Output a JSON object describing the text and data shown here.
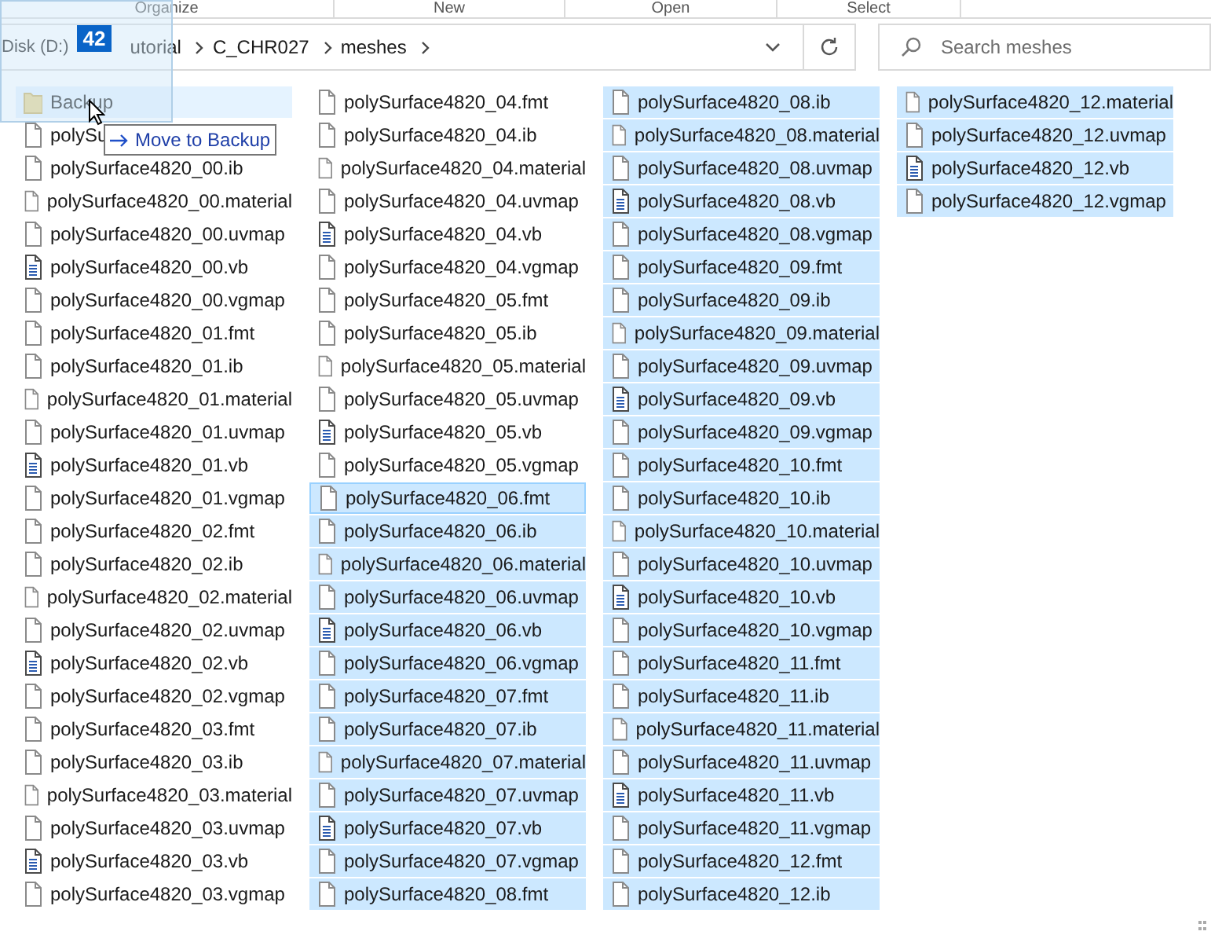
{
  "ribbon_groups": [
    "Organize",
    "New",
    "Open",
    "Select"
  ],
  "address_bar": {
    "segments": [
      "Disk (D:)",
      "utorial",
      "C_CHR027",
      "meshes"
    ]
  },
  "search": {
    "placeholder": "Search meshes"
  },
  "drag": {
    "count": "42",
    "tooltip": "Move to Backup"
  },
  "files": [
    {
      "name": "Backup",
      "kind": "folder",
      "selected": false,
      "focused": false,
      "hovered": true
    },
    {
      "name": "polySu",
      "kind": "file",
      "selected": false,
      "focused": false,
      "hovered": false
    },
    {
      "name": "polySurface4820_00.ib",
      "kind": "file",
      "selected": false,
      "focused": false,
      "hovered": false
    },
    {
      "name": "polySurface4820_00.material",
      "kind": "file",
      "selected": false,
      "focused": false,
      "hovered": false
    },
    {
      "name": "polySurface4820_00.uvmap",
      "kind": "file",
      "selected": false,
      "focused": false,
      "hovered": false
    },
    {
      "name": "polySurface4820_00.vb",
      "kind": "document",
      "selected": false,
      "focused": false,
      "hovered": false
    },
    {
      "name": "polySurface4820_00.vgmap",
      "kind": "file",
      "selected": false,
      "focused": false,
      "hovered": false
    },
    {
      "name": "polySurface4820_01.fmt",
      "kind": "file",
      "selected": false,
      "focused": false,
      "hovered": false
    },
    {
      "name": "polySurface4820_01.ib",
      "kind": "file",
      "selected": false,
      "focused": false,
      "hovered": false
    },
    {
      "name": "polySurface4820_01.material",
      "kind": "file",
      "selected": false,
      "focused": false,
      "hovered": false
    },
    {
      "name": "polySurface4820_01.uvmap",
      "kind": "file",
      "selected": false,
      "focused": false,
      "hovered": false
    },
    {
      "name": "polySurface4820_01.vb",
      "kind": "document",
      "selected": false,
      "focused": false,
      "hovered": false
    },
    {
      "name": "polySurface4820_01.vgmap",
      "kind": "file",
      "selected": false,
      "focused": false,
      "hovered": false
    },
    {
      "name": "polySurface4820_02.fmt",
      "kind": "file",
      "selected": false,
      "focused": false,
      "hovered": false
    },
    {
      "name": "polySurface4820_02.ib",
      "kind": "file",
      "selected": false,
      "focused": false,
      "hovered": false
    },
    {
      "name": "polySurface4820_02.material",
      "kind": "file",
      "selected": false,
      "focused": false,
      "hovered": false
    },
    {
      "name": "polySurface4820_02.uvmap",
      "kind": "file",
      "selected": false,
      "focused": false,
      "hovered": false
    },
    {
      "name": "polySurface4820_02.vb",
      "kind": "document",
      "selected": false,
      "focused": false,
      "hovered": false
    },
    {
      "name": "polySurface4820_02.vgmap",
      "kind": "file",
      "selected": false,
      "focused": false,
      "hovered": false
    },
    {
      "name": "polySurface4820_03.fmt",
      "kind": "file",
      "selected": false,
      "focused": false,
      "hovered": false
    },
    {
      "name": "polySurface4820_03.ib",
      "kind": "file",
      "selected": false,
      "focused": false,
      "hovered": false
    },
    {
      "name": "polySurface4820_03.material",
      "kind": "file",
      "selected": false,
      "focused": false,
      "hovered": false
    },
    {
      "name": "polySurface4820_03.uvmap",
      "kind": "file",
      "selected": false,
      "focused": false,
      "hovered": false
    },
    {
      "name": "polySurface4820_03.vb",
      "kind": "document",
      "selected": false,
      "focused": false,
      "hovered": false
    },
    {
      "name": "polySurface4820_03.vgmap",
      "kind": "file",
      "selected": false,
      "focused": false,
      "hovered": false
    },
    {
      "name": "polySurface4820_04.fmt",
      "kind": "file",
      "selected": false,
      "focused": false,
      "hovered": false
    },
    {
      "name": "polySurface4820_04.ib",
      "kind": "file",
      "selected": false,
      "focused": false,
      "hovered": false
    },
    {
      "name": "polySurface4820_04.material",
      "kind": "file",
      "selected": false,
      "focused": false,
      "hovered": false
    },
    {
      "name": "polySurface4820_04.uvmap",
      "kind": "file",
      "selected": false,
      "focused": false,
      "hovered": false
    },
    {
      "name": "polySurface4820_04.vb",
      "kind": "document",
      "selected": false,
      "focused": false,
      "hovered": false
    },
    {
      "name": "polySurface4820_04.vgmap",
      "kind": "file",
      "selected": false,
      "focused": false,
      "hovered": false
    },
    {
      "name": "polySurface4820_05.fmt",
      "kind": "file",
      "selected": false,
      "focused": false,
      "hovered": false
    },
    {
      "name": "polySurface4820_05.ib",
      "kind": "file",
      "selected": false,
      "focused": false,
      "hovered": false
    },
    {
      "name": "polySurface4820_05.material",
      "kind": "file",
      "selected": false,
      "focused": false,
      "hovered": false
    },
    {
      "name": "polySurface4820_05.uvmap",
      "kind": "file",
      "selected": false,
      "focused": false,
      "hovered": false
    },
    {
      "name": "polySurface4820_05.vb",
      "kind": "document",
      "selected": false,
      "focused": false,
      "hovered": false
    },
    {
      "name": "polySurface4820_05.vgmap",
      "kind": "file",
      "selected": false,
      "focused": false,
      "hovered": false
    },
    {
      "name": "polySurface4820_06.fmt",
      "kind": "file",
      "selected": true,
      "focused": true,
      "hovered": false
    },
    {
      "name": "polySurface4820_06.ib",
      "kind": "file",
      "selected": true,
      "focused": false,
      "hovered": false
    },
    {
      "name": "polySurface4820_06.material",
      "kind": "file",
      "selected": true,
      "focused": false,
      "hovered": false
    },
    {
      "name": "polySurface4820_06.uvmap",
      "kind": "file",
      "selected": true,
      "focused": false,
      "hovered": false
    },
    {
      "name": "polySurface4820_06.vb",
      "kind": "document",
      "selected": true,
      "focused": false,
      "hovered": false
    },
    {
      "name": "polySurface4820_06.vgmap",
      "kind": "file",
      "selected": true,
      "focused": false,
      "hovered": false
    },
    {
      "name": "polySurface4820_07.fmt",
      "kind": "file",
      "selected": true,
      "focused": false,
      "hovered": false
    },
    {
      "name": "polySurface4820_07.ib",
      "kind": "file",
      "selected": true,
      "focused": false,
      "hovered": false
    },
    {
      "name": "polySurface4820_07.material",
      "kind": "file",
      "selected": true,
      "focused": false,
      "hovered": false
    },
    {
      "name": "polySurface4820_07.uvmap",
      "kind": "file",
      "selected": true,
      "focused": false,
      "hovered": false
    },
    {
      "name": "polySurface4820_07.vb",
      "kind": "document",
      "selected": true,
      "focused": false,
      "hovered": false
    },
    {
      "name": "polySurface4820_07.vgmap",
      "kind": "file",
      "selected": true,
      "focused": false,
      "hovered": false
    },
    {
      "name": "polySurface4820_08.fmt",
      "kind": "file",
      "selected": true,
      "focused": false,
      "hovered": false
    },
    {
      "name": "polySurface4820_08.ib",
      "kind": "file",
      "selected": true,
      "focused": false,
      "hovered": false
    },
    {
      "name": "polySurface4820_08.material",
      "kind": "file",
      "selected": true,
      "focused": false,
      "hovered": false
    },
    {
      "name": "polySurface4820_08.uvmap",
      "kind": "file",
      "selected": true,
      "focused": false,
      "hovered": false
    },
    {
      "name": "polySurface4820_08.vb",
      "kind": "document",
      "selected": true,
      "focused": false,
      "hovered": false
    },
    {
      "name": "polySurface4820_08.vgmap",
      "kind": "file",
      "selected": true,
      "focused": false,
      "hovered": false
    },
    {
      "name": "polySurface4820_09.fmt",
      "kind": "file",
      "selected": true,
      "focused": false,
      "hovered": false
    },
    {
      "name": "polySurface4820_09.ib",
      "kind": "file",
      "selected": true,
      "focused": false,
      "hovered": false
    },
    {
      "name": "polySurface4820_09.material",
      "kind": "file",
      "selected": true,
      "focused": false,
      "hovered": false
    },
    {
      "name": "polySurface4820_09.uvmap",
      "kind": "file",
      "selected": true,
      "focused": false,
      "hovered": false
    },
    {
      "name": "polySurface4820_09.vb",
      "kind": "document",
      "selected": true,
      "focused": false,
      "hovered": false
    },
    {
      "name": "polySurface4820_09.vgmap",
      "kind": "file",
      "selected": true,
      "focused": false,
      "hovered": false
    },
    {
      "name": "polySurface4820_10.fmt",
      "kind": "file",
      "selected": true,
      "focused": false,
      "hovered": false
    },
    {
      "name": "polySurface4820_10.ib",
      "kind": "file",
      "selected": true,
      "focused": false,
      "hovered": false
    },
    {
      "name": "polySurface4820_10.material",
      "kind": "file",
      "selected": true,
      "focused": false,
      "hovered": false
    },
    {
      "name": "polySurface4820_10.uvmap",
      "kind": "file",
      "selected": true,
      "focused": false,
      "hovered": false
    },
    {
      "name": "polySurface4820_10.vb",
      "kind": "document",
      "selected": true,
      "focused": false,
      "hovered": false
    },
    {
      "name": "polySurface4820_10.vgmap",
      "kind": "file",
      "selected": true,
      "focused": false,
      "hovered": false
    },
    {
      "name": "polySurface4820_11.fmt",
      "kind": "file",
      "selected": true,
      "focused": false,
      "hovered": false
    },
    {
      "name": "polySurface4820_11.ib",
      "kind": "file",
      "selected": true,
      "focused": false,
      "hovered": false
    },
    {
      "name": "polySurface4820_11.material",
      "kind": "file",
      "selected": true,
      "focused": false,
      "hovered": false
    },
    {
      "name": "polySurface4820_11.uvmap",
      "kind": "file",
      "selected": true,
      "focused": false,
      "hovered": false
    },
    {
      "name": "polySurface4820_11.vb",
      "kind": "document",
      "selected": true,
      "focused": false,
      "hovered": false
    },
    {
      "name": "polySurface4820_11.vgmap",
      "kind": "file",
      "selected": true,
      "focused": false,
      "hovered": false
    },
    {
      "name": "polySurface4820_12.fmt",
      "kind": "file",
      "selected": true,
      "focused": false,
      "hovered": false
    },
    {
      "name": "polySurface4820_12.ib",
      "kind": "file",
      "selected": true,
      "focused": false,
      "hovered": false
    },
    {
      "name": "polySurface4820_12.material",
      "kind": "file",
      "selected": true,
      "focused": false,
      "hovered": false
    },
    {
      "name": "polySurface4820_12.uvmap",
      "kind": "file",
      "selected": true,
      "focused": false,
      "hovered": false
    },
    {
      "name": "polySurface4820_12.vb",
      "kind": "document",
      "selected": true,
      "focused": false,
      "hovered": false
    },
    {
      "name": "polySurface4820_12.vgmap",
      "kind": "file",
      "selected": true,
      "focused": false,
      "hovered": false
    }
  ]
}
